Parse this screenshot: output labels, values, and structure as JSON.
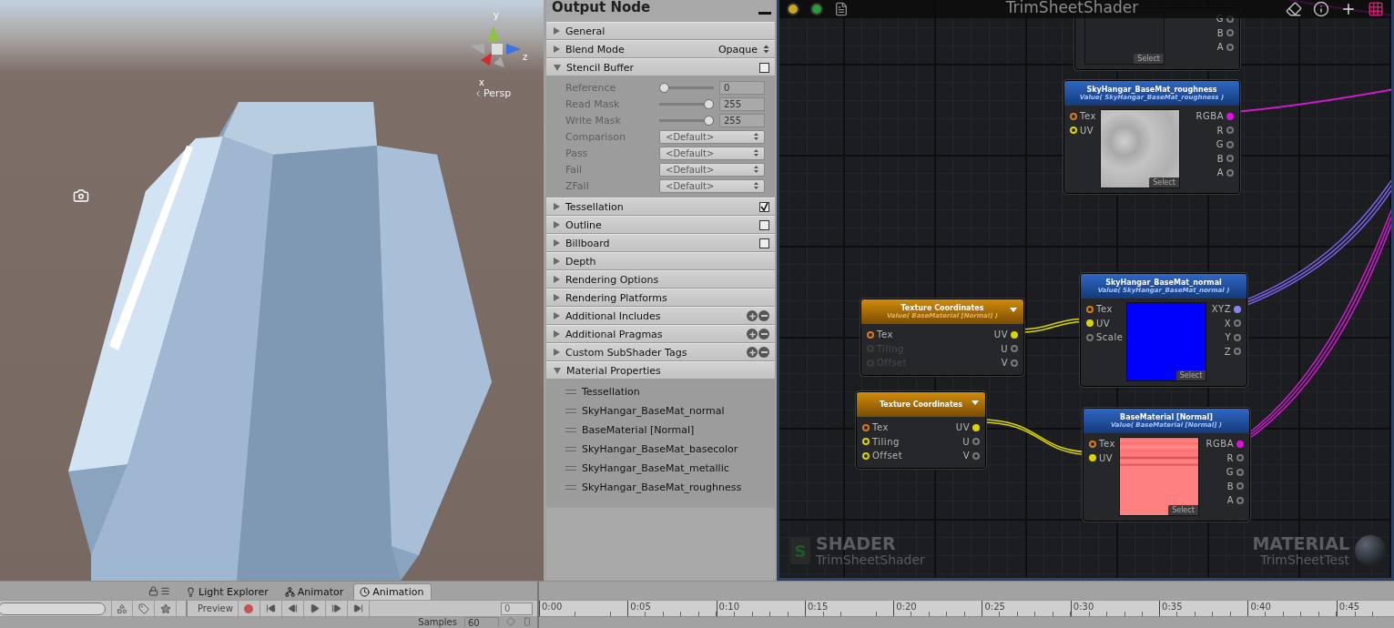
{
  "scene": {
    "gizmo_axes": [
      "y",
      "z",
      "x"
    ],
    "projection": "Persp"
  },
  "output_panel": {
    "title": "Output Node",
    "sections": [
      {
        "label": "General",
        "kind": "plain",
        "expanded": false
      },
      {
        "label": "Blend Mode",
        "kind": "dropdown",
        "value": "Opaque",
        "expanded": false
      },
      {
        "label": "Stencil Buffer",
        "kind": "toggle",
        "checked": false,
        "expanded": true,
        "fields": [
          {
            "label": "Reference",
            "kind": "slider",
            "level": 0,
            "value": "0"
          },
          {
            "label": "Read Mask",
            "kind": "slider",
            "level": 1,
            "value": "255"
          },
          {
            "label": "Write Mask",
            "kind": "slider",
            "level": 1,
            "value": "255"
          },
          {
            "label": "Comparison",
            "kind": "dropdown",
            "value": "<Default>"
          },
          {
            "label": "Pass",
            "kind": "dropdown",
            "value": "<Default>"
          },
          {
            "label": "Fail",
            "kind": "dropdown",
            "value": "<Default>"
          },
          {
            "label": "ZFail",
            "kind": "dropdown",
            "value": "<Default>"
          }
        ]
      },
      {
        "label": "Tessellation",
        "kind": "toggle",
        "checked": true,
        "expanded": false
      },
      {
        "label": "Outline",
        "kind": "toggle",
        "checked": false,
        "expanded": false
      },
      {
        "label": "Billboard",
        "kind": "toggle",
        "checked": false,
        "expanded": false
      },
      {
        "label": "Depth",
        "kind": "plain",
        "expanded": false
      },
      {
        "label": "Rendering Options",
        "kind": "plain",
        "expanded": false
      },
      {
        "label": "Rendering Platforms",
        "kind": "plain",
        "expanded": false
      },
      {
        "label": "Additional Includes",
        "kind": "list_edit",
        "expanded": false
      },
      {
        "label": "Additional Pragmas",
        "kind": "list_edit",
        "expanded": false
      },
      {
        "label": "Custom SubShader Tags",
        "kind": "list_edit",
        "expanded": false
      },
      {
        "label": "Material Properties",
        "kind": "plain",
        "expanded": true,
        "items": [
          "Tessellation",
          "SkyHangar_BaseMat_normal",
          "BaseMaterial [Normal]",
          "SkyHangar_BaseMat_basecolor",
          "SkyHangar_BaseMat_metallic",
          "SkyHangar_BaseMat_roughness"
        ]
      }
    ]
  },
  "graph": {
    "title": "TrimSheetShader",
    "nodes": [
      {
        "kind": "partial",
        "preview": {
          "kind": "blank",
          "select_label": "Select"
        },
        "outputs": [
          {
            "label": "G",
            "kind": "float",
            "connected": false
          },
          {
            "label": "B",
            "kind": "float",
            "connected": false
          },
          {
            "label": "A",
            "kind": "float",
            "connected": false
          }
        ]
      },
      {
        "kind": "texture_sample",
        "title": "SkyHangar_BaseMat_roughness",
        "subtitle": "Value( SkyHangar_BaseMat_roughness )",
        "preview": {
          "kind": "noise",
          "select_label": "Select"
        },
        "inputs": [
          {
            "label": "Tex",
            "kind": "tex",
            "connected": false,
            "enabled": true
          },
          {
            "label": "UV",
            "kind": "uv",
            "connected": false,
            "enabled": true
          }
        ],
        "outputs": [
          {
            "label": "RGBA",
            "kind": "color",
            "connected": true
          },
          {
            "label": "R",
            "kind": "float",
            "connected": false
          },
          {
            "label": "G",
            "kind": "float",
            "connected": false
          },
          {
            "label": "B",
            "kind": "float",
            "connected": false
          },
          {
            "label": "A",
            "kind": "float",
            "connected": false
          }
        ]
      },
      {
        "kind": "texture_sample",
        "title": "SkyHangar_BaseMat_normal",
        "subtitle": "Value( SkyHangar_BaseMat_normal )",
        "preview": {
          "kind": "solid_blue",
          "select_label": "Select"
        },
        "inputs": [
          {
            "label": "Tex",
            "kind": "tex",
            "connected": false,
            "enabled": true
          },
          {
            "label": "UV",
            "kind": "uv",
            "connected": true,
            "enabled": true
          },
          {
            "label": "Scale",
            "kind": "float",
            "connected": false,
            "enabled": true
          }
        ],
        "outputs": [
          {
            "label": "XYZ",
            "kind": "vec3",
            "connected": true
          },
          {
            "label": "X",
            "kind": "float",
            "connected": false
          },
          {
            "label": "Y",
            "kind": "float",
            "connected": false
          },
          {
            "label": "Z",
            "kind": "float",
            "connected": false
          }
        ]
      },
      {
        "kind": "texture_coordinates",
        "title": "Texture Coordinates",
        "subtitle": "Value( BaseMaterial [Normal] )",
        "inputs": [
          {
            "label": "Tex",
            "kind": "tex",
            "connected": false,
            "enabled": true
          },
          {
            "label": "Tiling",
            "kind": "uv",
            "connected": false,
            "enabled": false
          },
          {
            "label": "Offset",
            "kind": "uv",
            "connected": false,
            "enabled": false
          }
        ],
        "outputs": [
          {
            "label": "UV",
            "kind": "uv",
            "connected": true
          },
          {
            "label": "U",
            "kind": "float",
            "connected": false
          },
          {
            "label": "V",
            "kind": "float",
            "connected": false
          }
        ]
      },
      {
        "kind": "texture_coordinates",
        "title": "Texture Coordinates",
        "inputs": [
          {
            "label": "Tex",
            "kind": "tex",
            "connected": false,
            "enabled": true
          },
          {
            "label": "Tiling",
            "kind": "uv",
            "connected": false,
            "enabled": true
          },
          {
            "label": "Offset",
            "kind": "uv",
            "connected": false,
            "enabled": true
          }
        ],
        "outputs": [
          {
            "label": "UV",
            "kind": "uv",
            "connected": true
          },
          {
            "label": "U",
            "kind": "float",
            "connected": false
          },
          {
            "label": "V",
            "kind": "float",
            "connected": false
          }
        ]
      },
      {
        "kind": "texture_sample",
        "title": "BaseMaterial [Normal]",
        "subtitle": "Value( BaseMaterial [Normal] )",
        "preview": {
          "kind": "stripes",
          "select_label": "Select"
        },
        "inputs": [
          {
            "label": "Tex",
            "kind": "tex",
            "connected": false,
            "enabled": true
          },
          {
            "label": "UV",
            "kind": "uv",
            "connected": true,
            "enabled": true
          }
        ],
        "outputs": [
          {
            "label": "RGBA",
            "kind": "color",
            "connected": true
          },
          {
            "label": "R",
            "kind": "float",
            "connected": false
          },
          {
            "label": "G",
            "kind": "float",
            "connected": false
          },
          {
            "label": "B",
            "kind": "float",
            "connected": false
          },
          {
            "label": "A",
            "kind": "float",
            "connected": false
          }
        ]
      }
    ],
    "shader_label": "SHADER",
    "shader_name": "TrimSheetShader",
    "shader_icon_letter": "S",
    "material_label": "MATERIAL",
    "material_name": "TrimSheetTest"
  },
  "bottom": {
    "tabs": [
      {
        "label": "Light Explorer",
        "selected": false
      },
      {
        "label": "Animator",
        "selected": false
      },
      {
        "label": "Animation",
        "selected": true
      }
    ],
    "preview_label": "Preview",
    "frame": "0",
    "samples_label": "Samples",
    "samples": "60",
    "ticks": [
      "0:00",
      "0:05",
      "0:10",
      "0:15",
      "0:20",
      "0:25",
      "0:30",
      "0:35",
      "0:40",
      "0:45"
    ]
  }
}
